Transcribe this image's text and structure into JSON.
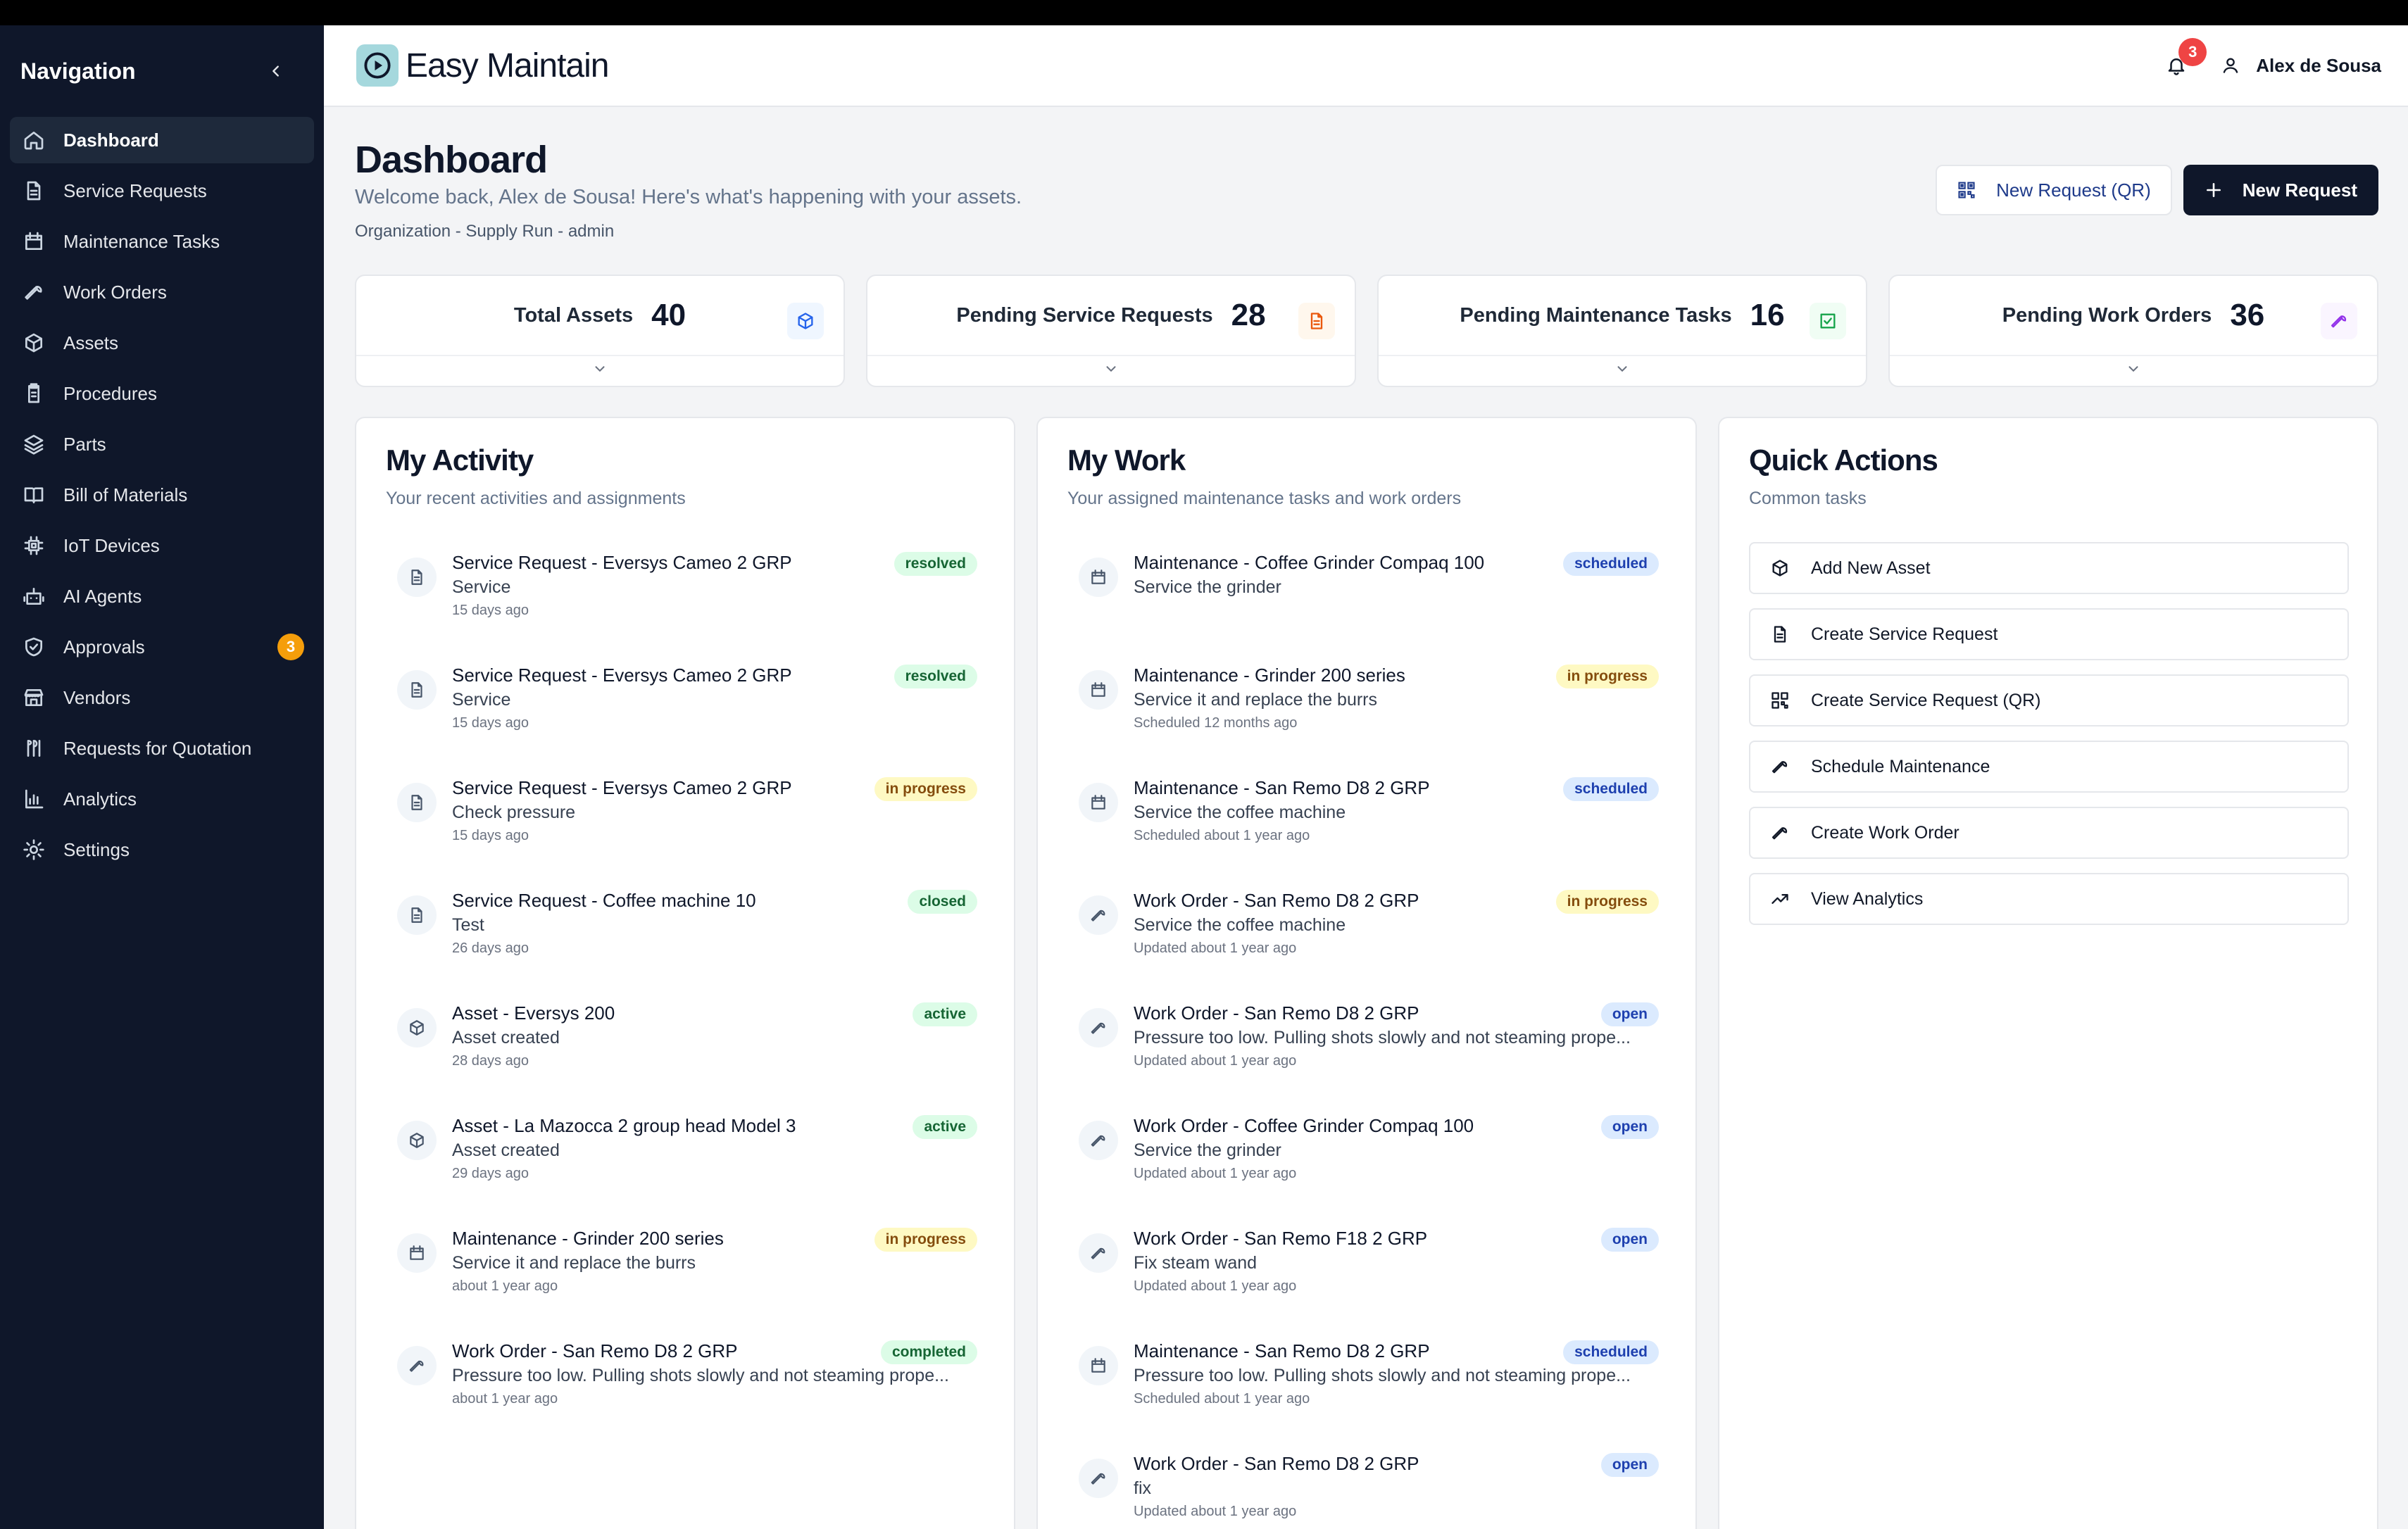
{
  "sidebar": {
    "title": "Navigation",
    "items": [
      {
        "label": "Dashboard",
        "icon": "home-icon",
        "badge": null
      },
      {
        "label": "Service Requests",
        "icon": "document-icon",
        "badge": null
      },
      {
        "label": "Maintenance Tasks",
        "icon": "calendar-icon",
        "badge": null
      },
      {
        "label": "Work Orders",
        "icon": "wrench-icon",
        "badge": null
      },
      {
        "label": "Assets",
        "icon": "box-icon",
        "badge": null
      },
      {
        "label": "Procedures",
        "icon": "clipboard-icon",
        "badge": null
      },
      {
        "label": "Parts",
        "icon": "layers-icon",
        "badge": null
      },
      {
        "label": "Bill of Materials",
        "icon": "book-icon",
        "badge": null
      },
      {
        "label": "IoT Devices",
        "icon": "chip-icon",
        "badge": null
      },
      {
        "label": "AI Agents",
        "icon": "bot-icon",
        "badge": null
      },
      {
        "label": "Approvals",
        "icon": "shield-check-icon",
        "badge": "3"
      },
      {
        "label": "Vendors",
        "icon": "store-icon",
        "badge": null
      },
      {
        "label": "Requests for Quotation",
        "icon": "quote-icon",
        "badge": null
      },
      {
        "label": "Analytics",
        "icon": "bar-chart-icon",
        "badge": null
      },
      {
        "label": "Settings",
        "icon": "gear-icon",
        "badge": null
      }
    ]
  },
  "header": {
    "brand": "Easy Maintain",
    "notifications_count": "3",
    "user_name": "Alex de Sousa"
  },
  "page": {
    "title": "Dashboard",
    "subtitle": "Welcome back, Alex de Sousa! Here's what's happening with your assets.",
    "org": "Organization - Supply Run - admin",
    "btn_qr": "New Request (QR)",
    "btn_new": "New Request"
  },
  "stats": [
    {
      "label": "Total Assets",
      "value": "40",
      "icon": "box-icon",
      "color": "#2563eb",
      "bg": "#eff6ff"
    },
    {
      "label": "Pending Service Requests",
      "value": "28",
      "icon": "document-icon",
      "color": "#ea580c",
      "bg": "#fff7ed"
    },
    {
      "label": "Pending Maintenance Tasks",
      "value": "16",
      "icon": "check-square-icon",
      "color": "#16a34a",
      "bg": "#f0fdf4"
    },
    {
      "label": "Pending Work Orders",
      "value": "36",
      "icon": "wrench-icon",
      "color": "#9333ea",
      "bg": "#faf5ff"
    }
  ],
  "activity": {
    "title": "My Activity",
    "subtitle": "Your recent activities and assignments",
    "items": [
      {
        "icon": "document-icon",
        "title": "Service Request - Eversys Cameo 2 GRP",
        "desc": "Service",
        "time": "15 days ago",
        "status": "resolved",
        "tone": "green"
      },
      {
        "icon": "document-icon",
        "title": "Service Request - Eversys Cameo 2 GRP",
        "desc": "Service",
        "time": "15 days ago",
        "status": "resolved",
        "tone": "green"
      },
      {
        "icon": "document-icon",
        "title": "Service Request - Eversys Cameo 2 GRP",
        "desc": "Check pressure",
        "time": "15 days ago",
        "status": "in progress",
        "tone": "yellow"
      },
      {
        "icon": "document-icon",
        "title": "Service Request - Coffee machine 10",
        "desc": "Test",
        "time": "26 days ago",
        "status": "closed",
        "tone": "green"
      },
      {
        "icon": "box-icon",
        "title": "Asset - Eversys 200",
        "desc": "Asset created",
        "time": "28 days ago",
        "status": "active",
        "tone": "green"
      },
      {
        "icon": "box-icon",
        "title": "Asset - La Mazocca 2 group head Model 3",
        "desc": "Asset created",
        "time": "29 days ago",
        "status": "active",
        "tone": "green"
      },
      {
        "icon": "calendar-icon",
        "title": "Maintenance - Grinder 200 series",
        "desc": "Service it and replace the burrs",
        "time": "about 1 year ago",
        "status": "in progress",
        "tone": "yellow"
      },
      {
        "icon": "wrench-icon",
        "title": "Work Order - San Remo D8 2 GRP",
        "desc": "Pressure too low. Pulling shots slowly and not steaming prope...",
        "time": "about 1 year ago",
        "status": "completed",
        "tone": "green"
      }
    ]
  },
  "work": {
    "title": "My Work",
    "subtitle": "Your assigned maintenance tasks and work orders",
    "items": [
      {
        "icon": "calendar-icon",
        "title": "Maintenance - Coffee Grinder Compaq 100",
        "desc": "Service the grinder",
        "time": "",
        "status": "scheduled",
        "tone": "blue"
      },
      {
        "icon": "calendar-icon",
        "title": "Maintenance - Grinder 200 series",
        "desc": "Service it and replace the burrs",
        "time": "Scheduled 12 months ago",
        "status": "in progress",
        "tone": "yellow"
      },
      {
        "icon": "calendar-icon",
        "title": "Maintenance - San Remo D8 2 GRP",
        "desc": "Service the coffee machine",
        "time": "Scheduled about 1 year ago",
        "status": "scheduled",
        "tone": "blue"
      },
      {
        "icon": "wrench-icon",
        "title": "Work Order - San Remo D8 2 GRP",
        "desc": "Service the coffee machine",
        "time": "Updated about 1 year ago",
        "status": "in progress",
        "tone": "yellow"
      },
      {
        "icon": "wrench-icon",
        "title": "Work Order - San Remo D8 2 GRP",
        "desc": "Pressure too low. Pulling shots slowly and not steaming prope...",
        "time": "Updated about 1 year ago",
        "status": "open",
        "tone": "blue"
      },
      {
        "icon": "wrench-icon",
        "title": "Work Order - Coffee Grinder Compaq 100",
        "desc": "Service the grinder",
        "time": "Updated about 1 year ago",
        "status": "open",
        "tone": "blue"
      },
      {
        "icon": "wrench-icon",
        "title": "Work Order - San Remo F18 2 GRP",
        "desc": "Fix steam wand",
        "time": "Updated about 1 year ago",
        "status": "open",
        "tone": "blue"
      },
      {
        "icon": "calendar-icon",
        "title": "Maintenance - San Remo D8 2 GRP",
        "desc": "Pressure too low. Pulling shots slowly and not steaming prope...",
        "time": "Scheduled about 1 year ago",
        "status": "scheduled",
        "tone": "blue"
      },
      {
        "icon": "wrench-icon",
        "title": "Work Order - San Remo D8 2 GRP",
        "desc": "fix",
        "time": "Updated about 1 year ago",
        "status": "open",
        "tone": "blue"
      }
    ]
  },
  "quick": {
    "title": "Quick Actions",
    "subtitle": "Common tasks",
    "items": [
      {
        "label": "Add New Asset",
        "icon": "box-icon"
      },
      {
        "label": "Create Service Request",
        "icon": "document-icon"
      },
      {
        "label": "Create Service Request (QR)",
        "icon": "qr-icon"
      },
      {
        "label": "Schedule Maintenance",
        "icon": "wrench-icon"
      },
      {
        "label": "Create Work Order",
        "icon": "wrench-icon"
      },
      {
        "label": "View Analytics",
        "icon": "trend-up-icon"
      }
    ]
  }
}
